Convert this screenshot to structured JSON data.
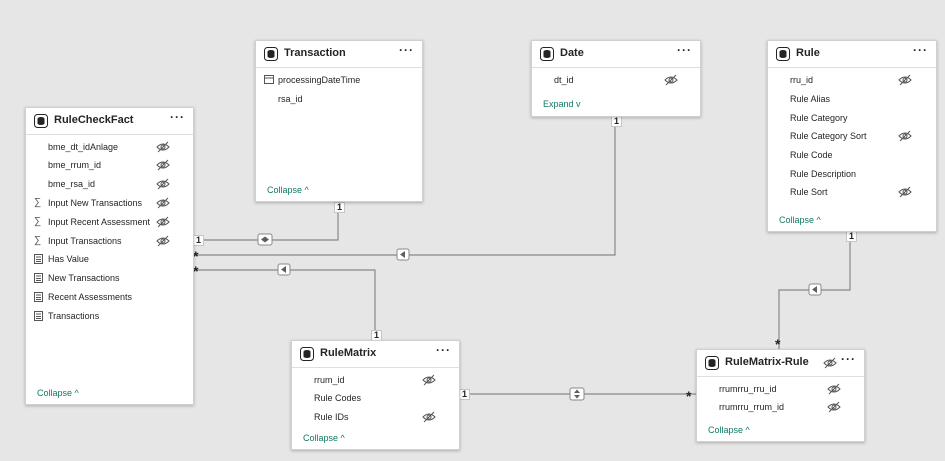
{
  "tables": {
    "transaction": {
      "title": "Transaction",
      "more": "···",
      "fields": [
        "processingDateTime",
        "rsa_id"
      ],
      "footer": "Collapse"
    },
    "date": {
      "title": "Date",
      "more": "···",
      "fields": [
        "dt_id"
      ],
      "footer": "Expand"
    },
    "rule": {
      "title": "Rule",
      "more": "···",
      "fields": [
        "rru_id",
        "Rule Alias",
        "Rule Category",
        "Rule Category Sort",
        "Rule Code",
        "Rule Description",
        "Rule Sort"
      ],
      "footer": "Collapse"
    },
    "rulecheckfact": {
      "title": "RuleCheckFact",
      "more": "···",
      "fields": [
        "bme_dt_idAnlage",
        "bme_rrum_id",
        "bme_rsa_id",
        "Input New Transactions",
        "Input Recent Assessment",
        "Input Transactions",
        "Has Value",
        "New Transactions",
        "Recent Assessments",
        "Transactions"
      ],
      "footer": "Collapse"
    },
    "rulematrix": {
      "title": "RuleMatrix",
      "more": "···",
      "fields": [
        "rrum_id",
        "Rule Codes",
        "Rule IDs"
      ],
      "footer": "Collapse"
    },
    "rulematrixrule": {
      "title": "RuleMatrix-Rule",
      "more": "···",
      "fields": [
        "rrumrru_rru_id",
        "rrumrru_rrum_id"
      ],
      "footer": "Collapse"
    }
  },
  "cardinality": {
    "one": "1",
    "many": "*"
  },
  "icons": {
    "table": "table-icon",
    "hidden": "eye-hidden-icon",
    "sigma": "∑",
    "measure": "calculator-icon",
    "accent": "#117865"
  }
}
